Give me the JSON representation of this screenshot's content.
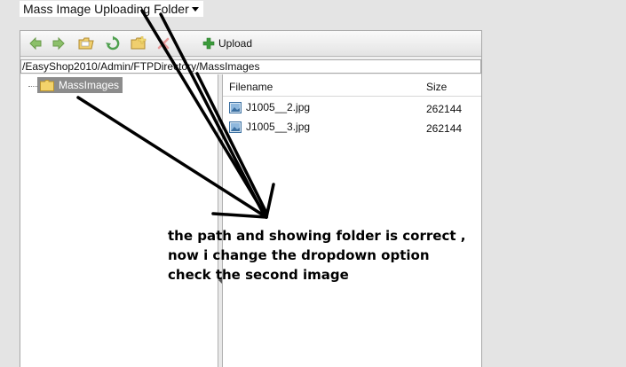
{
  "dropdown": {
    "selected": "Mass Image Uploading Folder"
  },
  "toolbar": {
    "buttons": [
      {
        "icon": "arrow-left-icon",
        "color": "#7ab55c"
      },
      {
        "icon": "arrow-right-icon",
        "color": "#7ab55c"
      },
      {
        "icon": "open-folder-icon",
        "color": "#e8c15a"
      },
      {
        "icon": "refresh-icon",
        "color": "#4fa04f"
      },
      {
        "icon": "new-folder-icon",
        "color": "#e8c15a"
      },
      {
        "icon": "delete-icon",
        "color": "#e89090"
      }
    ],
    "upload_label": "Upload",
    "upload_icon_color": "#3a9a3a"
  },
  "path": "/EasyShop2010/Admin/FTPDirectory/MassImages",
  "tree": {
    "folder_label": "MassImages"
  },
  "file_list": {
    "columns": {
      "name": "Filename",
      "size": "Size"
    },
    "rows": [
      {
        "name": "J1005__2.jpg",
        "size": "262144"
      },
      {
        "name": "J1005__3.jpg",
        "size": "262144"
      }
    ]
  },
  "annotation": {
    "lines": [
      "the path and showing folder is correct ,",
      "now i change the dropdown option",
      "check the second image"
    ]
  }
}
